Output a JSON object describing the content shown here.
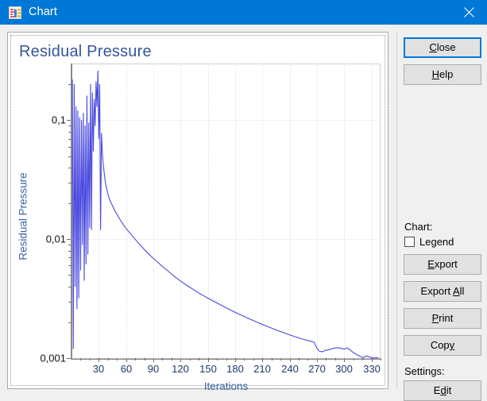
{
  "window": {
    "title": "Chart",
    "icon": "chart-icon",
    "close_label": "×",
    "titlebar_color": "#0078d7"
  },
  "chart_panel": {
    "title": "Residual Pressure",
    "title_color": "#35559a"
  },
  "chart_data": {
    "type": "line",
    "title": "Residual Pressure",
    "xlabel": "Iterations",
    "ylabel": "Residual Pressure",
    "yscale": "log",
    "grid": true,
    "legend": false,
    "legend_position": "none",
    "series_color": "#4a4ae0",
    "xlim": [
      0,
      340
    ],
    "ylim": [
      0.001,
      0.3
    ],
    "xticks": [
      30,
      60,
      90,
      120,
      150,
      180,
      210,
      240,
      270,
      300,
      330
    ],
    "xtick_labels": [
      "30",
      "60",
      "90",
      "120",
      "150",
      "180",
      "210",
      "240",
      "270",
      "300",
      "330"
    ],
    "yticks": [
      0.1,
      0.01,
      0.001
    ],
    "ytick_labels": [
      "0,1",
      "0,01",
      "0,001"
    ],
    "series": [
      {
        "name": "Residual Pressure",
        "x": [
          1,
          2,
          3,
          4,
          5,
          6,
          7,
          8,
          9,
          10,
          11,
          12,
          13,
          14,
          15,
          16,
          17,
          18,
          19,
          20,
          21,
          22,
          23,
          24,
          25,
          26,
          27,
          28,
          29,
          30,
          31,
          32,
          33,
          34,
          35,
          36,
          37,
          38,
          39,
          40,
          42,
          44,
          46,
          48,
          50,
          53,
          56,
          59,
          62,
          65,
          68,
          71,
          74,
          77,
          80,
          85,
          90,
          95,
          100,
          105,
          110,
          115,
          120,
          125,
          130,
          135,
          140,
          145,
          150,
          155,
          160,
          165,
          170,
          175,
          180,
          185,
          190,
          195,
          200,
          205,
          210,
          215,
          220,
          225,
          230,
          235,
          240,
          245,
          250,
          255,
          258,
          261,
          264,
          267,
          270,
          273,
          276,
          279,
          282,
          285,
          288,
          291,
          294,
          297,
          300,
          303,
          306,
          309,
          312,
          315,
          318,
          321,
          324,
          327,
          330,
          333,
          336,
          338
        ],
        "y": [
          0.22,
          0.0012,
          0.2,
          0.004,
          0.13,
          0.0026,
          0.12,
          0.0032,
          0.105,
          0.0055,
          0.1,
          0.009,
          0.115,
          0.0045,
          0.09,
          0.0062,
          0.16,
          0.0075,
          0.095,
          0.0125,
          0.2,
          0.012,
          0.17,
          0.055,
          0.15,
          0.09,
          0.21,
          0.13,
          0.26,
          0.07,
          0.2,
          0.012,
          0.078,
          0.052,
          0.042,
          0.036,
          0.031,
          0.028,
          0.026,
          0.024,
          0.0215,
          0.0198,
          0.0185,
          0.0172,
          0.0162,
          0.0148,
          0.0136,
          0.0126,
          0.0118,
          0.0111,
          0.0104,
          0.0098,
          0.0092,
          0.0087,
          0.0082,
          0.0075,
          0.0069,
          0.0064,
          0.0059,
          0.0055,
          0.0051,
          0.00475,
          0.00445,
          0.00418,
          0.00395,
          0.00373,
          0.00353,
          0.00336,
          0.0032,
          0.00305,
          0.00291,
          0.00278,
          0.00265,
          0.00254,
          0.00243,
          0.00233,
          0.00224,
          0.00215,
          0.00207,
          0.00199,
          0.00192,
          0.00185,
          0.00179,
          0.00173,
          0.00167,
          0.00162,
          0.00157,
          0.00152,
          0.00148,
          0.00144,
          0.00142,
          0.0014,
          0.00138,
          0.00136,
          0.00121,
          0.00114,
          0.00113,
          0.00116,
          0.00117,
          0.00119,
          0.00121,
          0.00122,
          0.00122,
          0.00121,
          0.00119,
          0.00122,
          0.00118,
          0.00113,
          0.00109,
          0.00106,
          0.00103,
          0.00101,
          0.00104,
          0.00103,
          0.00101,
          0.00099,
          0.00101,
          0.001
        ]
      }
    ]
  },
  "side_panel": {
    "close_button": "Close",
    "help_button": "Help",
    "chart_section_label": "Chart:",
    "legend_checkbox_label": "Legend",
    "legend_checked": false,
    "export_button": "Export",
    "export_all_button": "Export All",
    "print_button": "Print",
    "copy_button": "Copy",
    "settings_section_label": "Settings:",
    "edit_button": "Edit"
  }
}
